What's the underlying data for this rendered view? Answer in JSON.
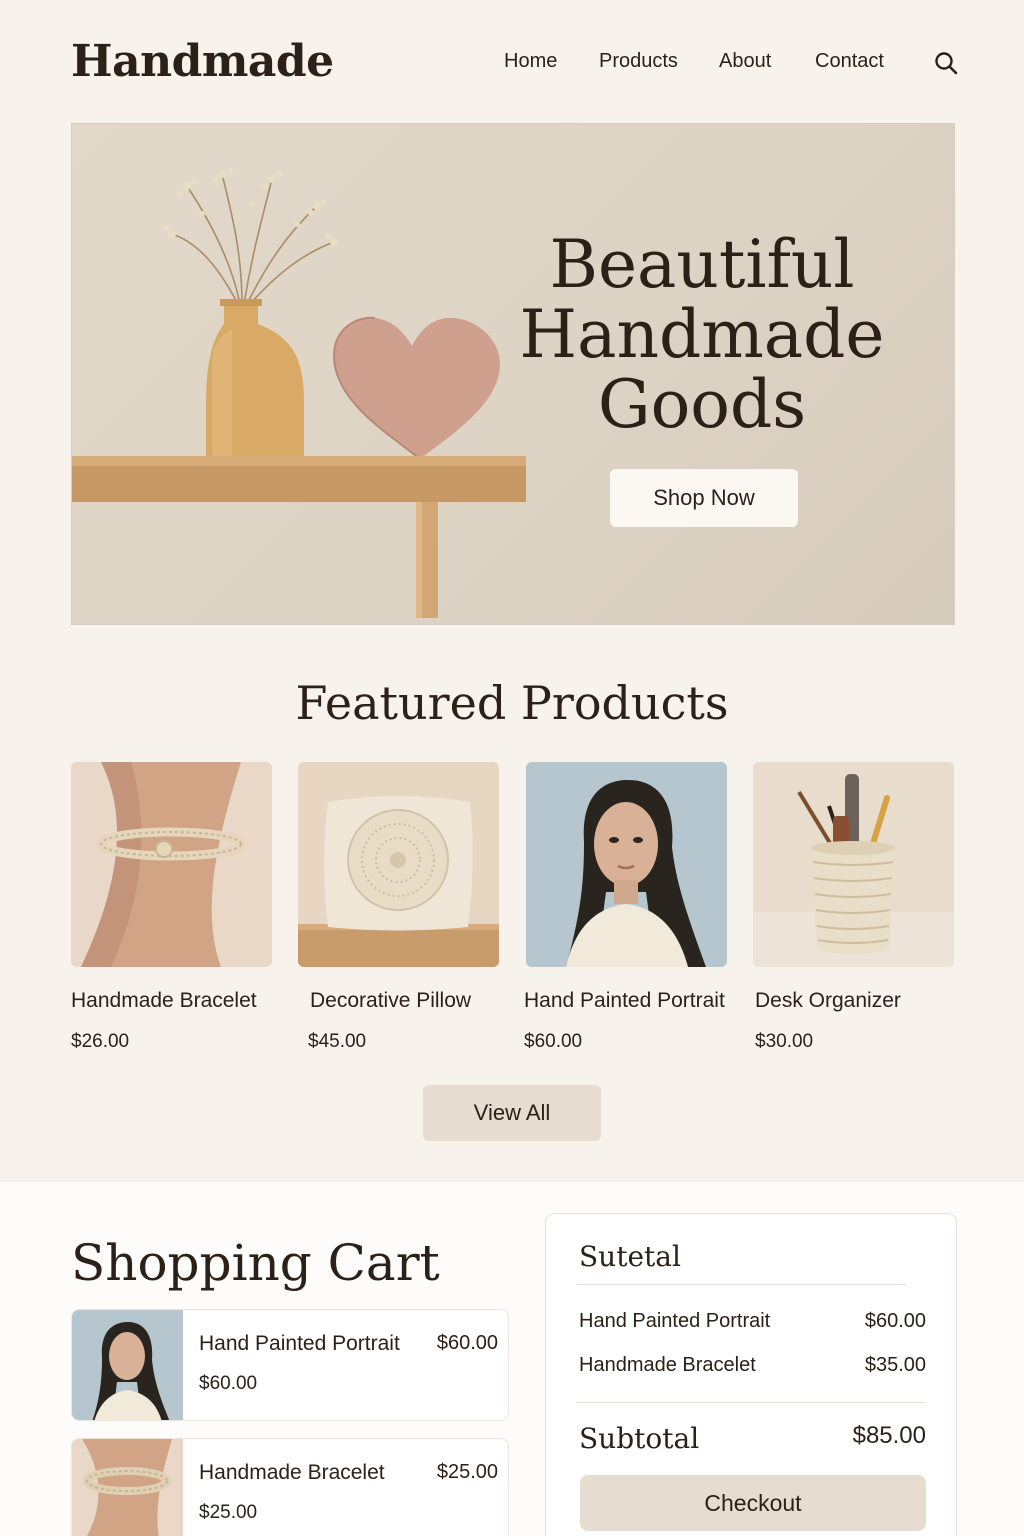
{
  "header": {
    "logo": "Handmade",
    "nav": [
      "Home",
      "Products",
      "About",
      "Contact"
    ],
    "search_icon": "search-icon"
  },
  "hero": {
    "title_lines": [
      "Beautiful",
      "Handmade",
      "Goods"
    ],
    "cta_label": "Shop Now"
  },
  "featured": {
    "title": "Featured Products",
    "products": [
      {
        "name": "Handmade Bracelet",
        "price": "$26.00",
        "icon": "bracelet-image"
      },
      {
        "name": "Decorative Pillow",
        "price": "$45.00",
        "icon": "pillow-image"
      },
      {
        "name": "Hand Painted Portrait",
        "price": "$60.00",
        "icon": "portrait-image"
      },
      {
        "name": "Desk Organizer",
        "price": "$30.00",
        "icon": "organizer-image"
      }
    ],
    "view_all_label": "View All"
  },
  "cart": {
    "title": "Shopping Cart",
    "items": [
      {
        "name": "Hand Painted Portrait",
        "price": "$60.00",
        "sub_price": "$60.00"
      },
      {
        "name": "Handmade Bracelet",
        "price": "$25.00",
        "sub_price": "$25.00"
      }
    ],
    "summary": {
      "title": "Sutetal",
      "rows": [
        {
          "name": "Hand Painted Portrait",
          "price": "$60.00"
        },
        {
          "name": "Handmade Bracelet",
          "price": "$35.00"
        }
      ],
      "subtotal_label": "Subtotal",
      "subtotal_value": "$85.00",
      "checkout_label": "Checkout"
    }
  },
  "colors": {
    "background": "#f7f3ec",
    "text": "#2b2118",
    "button_beige": "#e6ddd0",
    "hero_bg": "#ddd3c4"
  }
}
